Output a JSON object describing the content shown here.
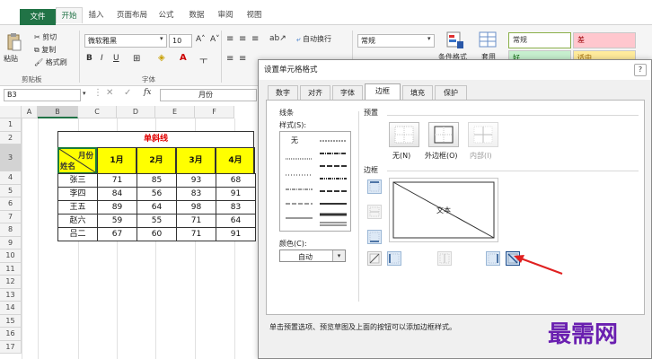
{
  "ribbon": {
    "tabs": [
      "文件",
      "开始",
      "插入",
      "页面布局",
      "公式",
      "数据",
      "审阅",
      "视图"
    ],
    "clipboard": {
      "paste": "粘贴",
      "cut": "剪切",
      "copy": "复制",
      "painter": "格式刷",
      "group": "剪贴板"
    },
    "font": {
      "name": "微软雅黑",
      "size": "10",
      "bold": "B",
      "italic": "I",
      "underline": "U",
      "group": "字体"
    },
    "alignment": {
      "wrap": "自动换行"
    },
    "number": {
      "format": "常规"
    },
    "styles": {
      "conditional": "条件格式",
      "table": "套用",
      "normal": "常规",
      "bad": "差",
      "good": "好",
      "neutral": "适中"
    }
  },
  "formula_bar": {
    "name_box": "B3",
    "fx": "fx",
    "content": "月份"
  },
  "sheet": {
    "columns": [
      "A",
      "B",
      "C",
      "D",
      "E",
      "F"
    ],
    "rows": [
      "1",
      "2",
      "3",
      "4",
      "5",
      "6",
      "7",
      "8",
      "9",
      "10",
      "11",
      "12",
      "13",
      "14",
      "15",
      "16",
      "17"
    ],
    "table": {
      "title": "单斜线",
      "header_top": "月份",
      "header_bottom": "姓名",
      "months": [
        "1月",
        "2月",
        "3月",
        "4月"
      ],
      "data": [
        {
          "name": "张三",
          "values": [
            "71",
            "85",
            "93",
            "68"
          ]
        },
        {
          "name": "李四",
          "values": [
            "84",
            "56",
            "83",
            "91"
          ]
        },
        {
          "name": "王五",
          "values": [
            "89",
            "64",
            "98",
            "83"
          ]
        },
        {
          "name": "赵六",
          "values": [
            "59",
            "55",
            "71",
            "64"
          ]
        },
        {
          "name": "吕二",
          "values": [
            "67",
            "60",
            "71",
            "91"
          ]
        }
      ]
    }
  },
  "dialog": {
    "title": "设置单元格格式",
    "tabs": [
      "数字",
      "对齐",
      "字体",
      "边框",
      "填充",
      "保护"
    ],
    "line_group": "线条",
    "style_label": "样式(S):",
    "none_style": "无",
    "color_label": "颜色(C):",
    "color_value": "自动",
    "presets_group": "预置",
    "preset_none": "无(N)",
    "preset_outline": "外边框(O)",
    "preset_inside": "内部(I)",
    "border_group": "边框",
    "preview_text": "文本",
    "hint": "单击预置选项、预览草图及上面的按钮可以添加边框样式。"
  },
  "watermark": {
    "text": "最需网",
    "color": "#6a1fb0"
  },
  "colors": {
    "accent": "#217346",
    "header_yellow": "#ffff00",
    "title_red": "#e00000",
    "arrow_red": "#e02020"
  }
}
